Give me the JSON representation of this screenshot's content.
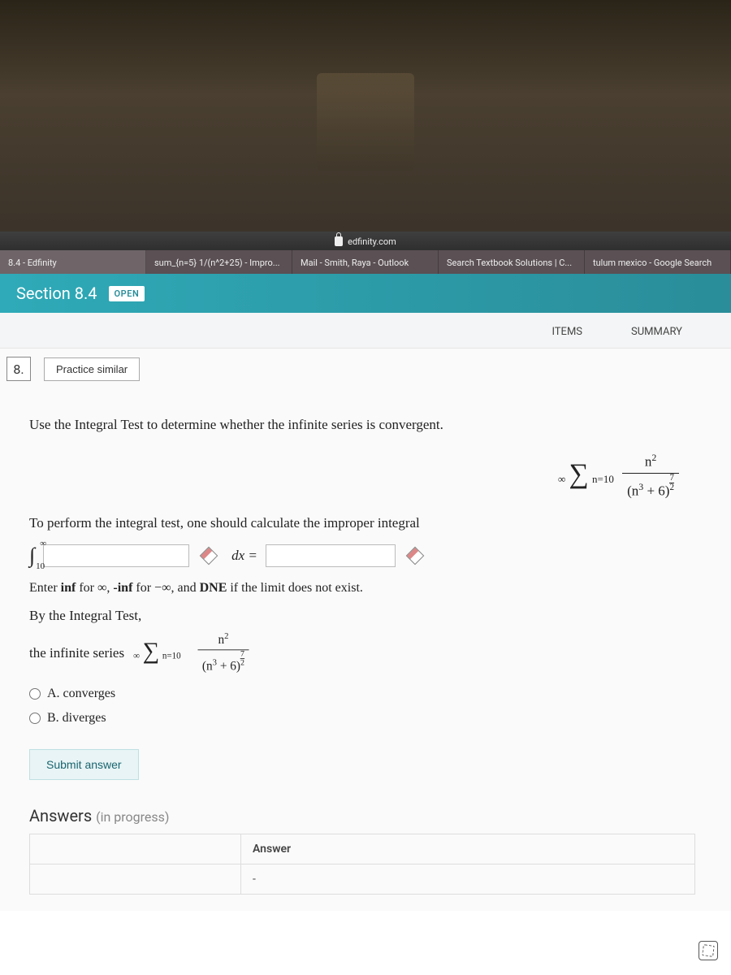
{
  "address_bar": {
    "url": "edfinity.com"
  },
  "tabs": [
    {
      "label": "8.4 - Edfinity"
    },
    {
      "label": "sum_{n=5} 1/(n^2+25) - Impro..."
    },
    {
      "label": "Mail - Smith, Raya - Outlook"
    },
    {
      "label": "Search Textbook Solutions | C..."
    },
    {
      "label": "tulum mexico - Google Search"
    }
  ],
  "section": {
    "title": "Section 8.4",
    "badge": "OPEN"
  },
  "nav": {
    "items_label": "ITEMS",
    "summary_label": "SUMMARY"
  },
  "question": {
    "number": "8.",
    "practice_label": "Practice similar",
    "prompt": "Use the Integral Test to determine whether the infinite series is convergent.",
    "series": {
      "upper": "∞",
      "lower": "n=10",
      "numerator": "n",
      "num_exp": "2",
      "den_base": "(n",
      "den_exp1": "3",
      "den_mid": " + 6)",
      "den_exp_num": "7",
      "den_exp_den": "2"
    },
    "instr": "To perform the integral test, one should calculate the improper integral",
    "integral_upper": "∞",
    "integral_lower": "10",
    "dx_label": "dx =",
    "hint_pre": "Enter ",
    "hint_inf": "inf",
    "hint_mid1": " for ∞, ",
    "hint_ninf": "-inf",
    "hint_mid2": " for −∞, and ",
    "hint_dne": "DNE",
    "hint_end": " if the limit does not exist.",
    "line2": "By the Integral Test,",
    "line3_pre": "the infinite series ",
    "option_a": "A. converges",
    "option_b": "B. diverges",
    "submit_label": "Submit answer"
  },
  "answers": {
    "title": "Answers",
    "progress": "(in progress)",
    "col_blank": "",
    "col_answer": "Answer",
    "row1_left": "",
    "row1_right": "-"
  }
}
